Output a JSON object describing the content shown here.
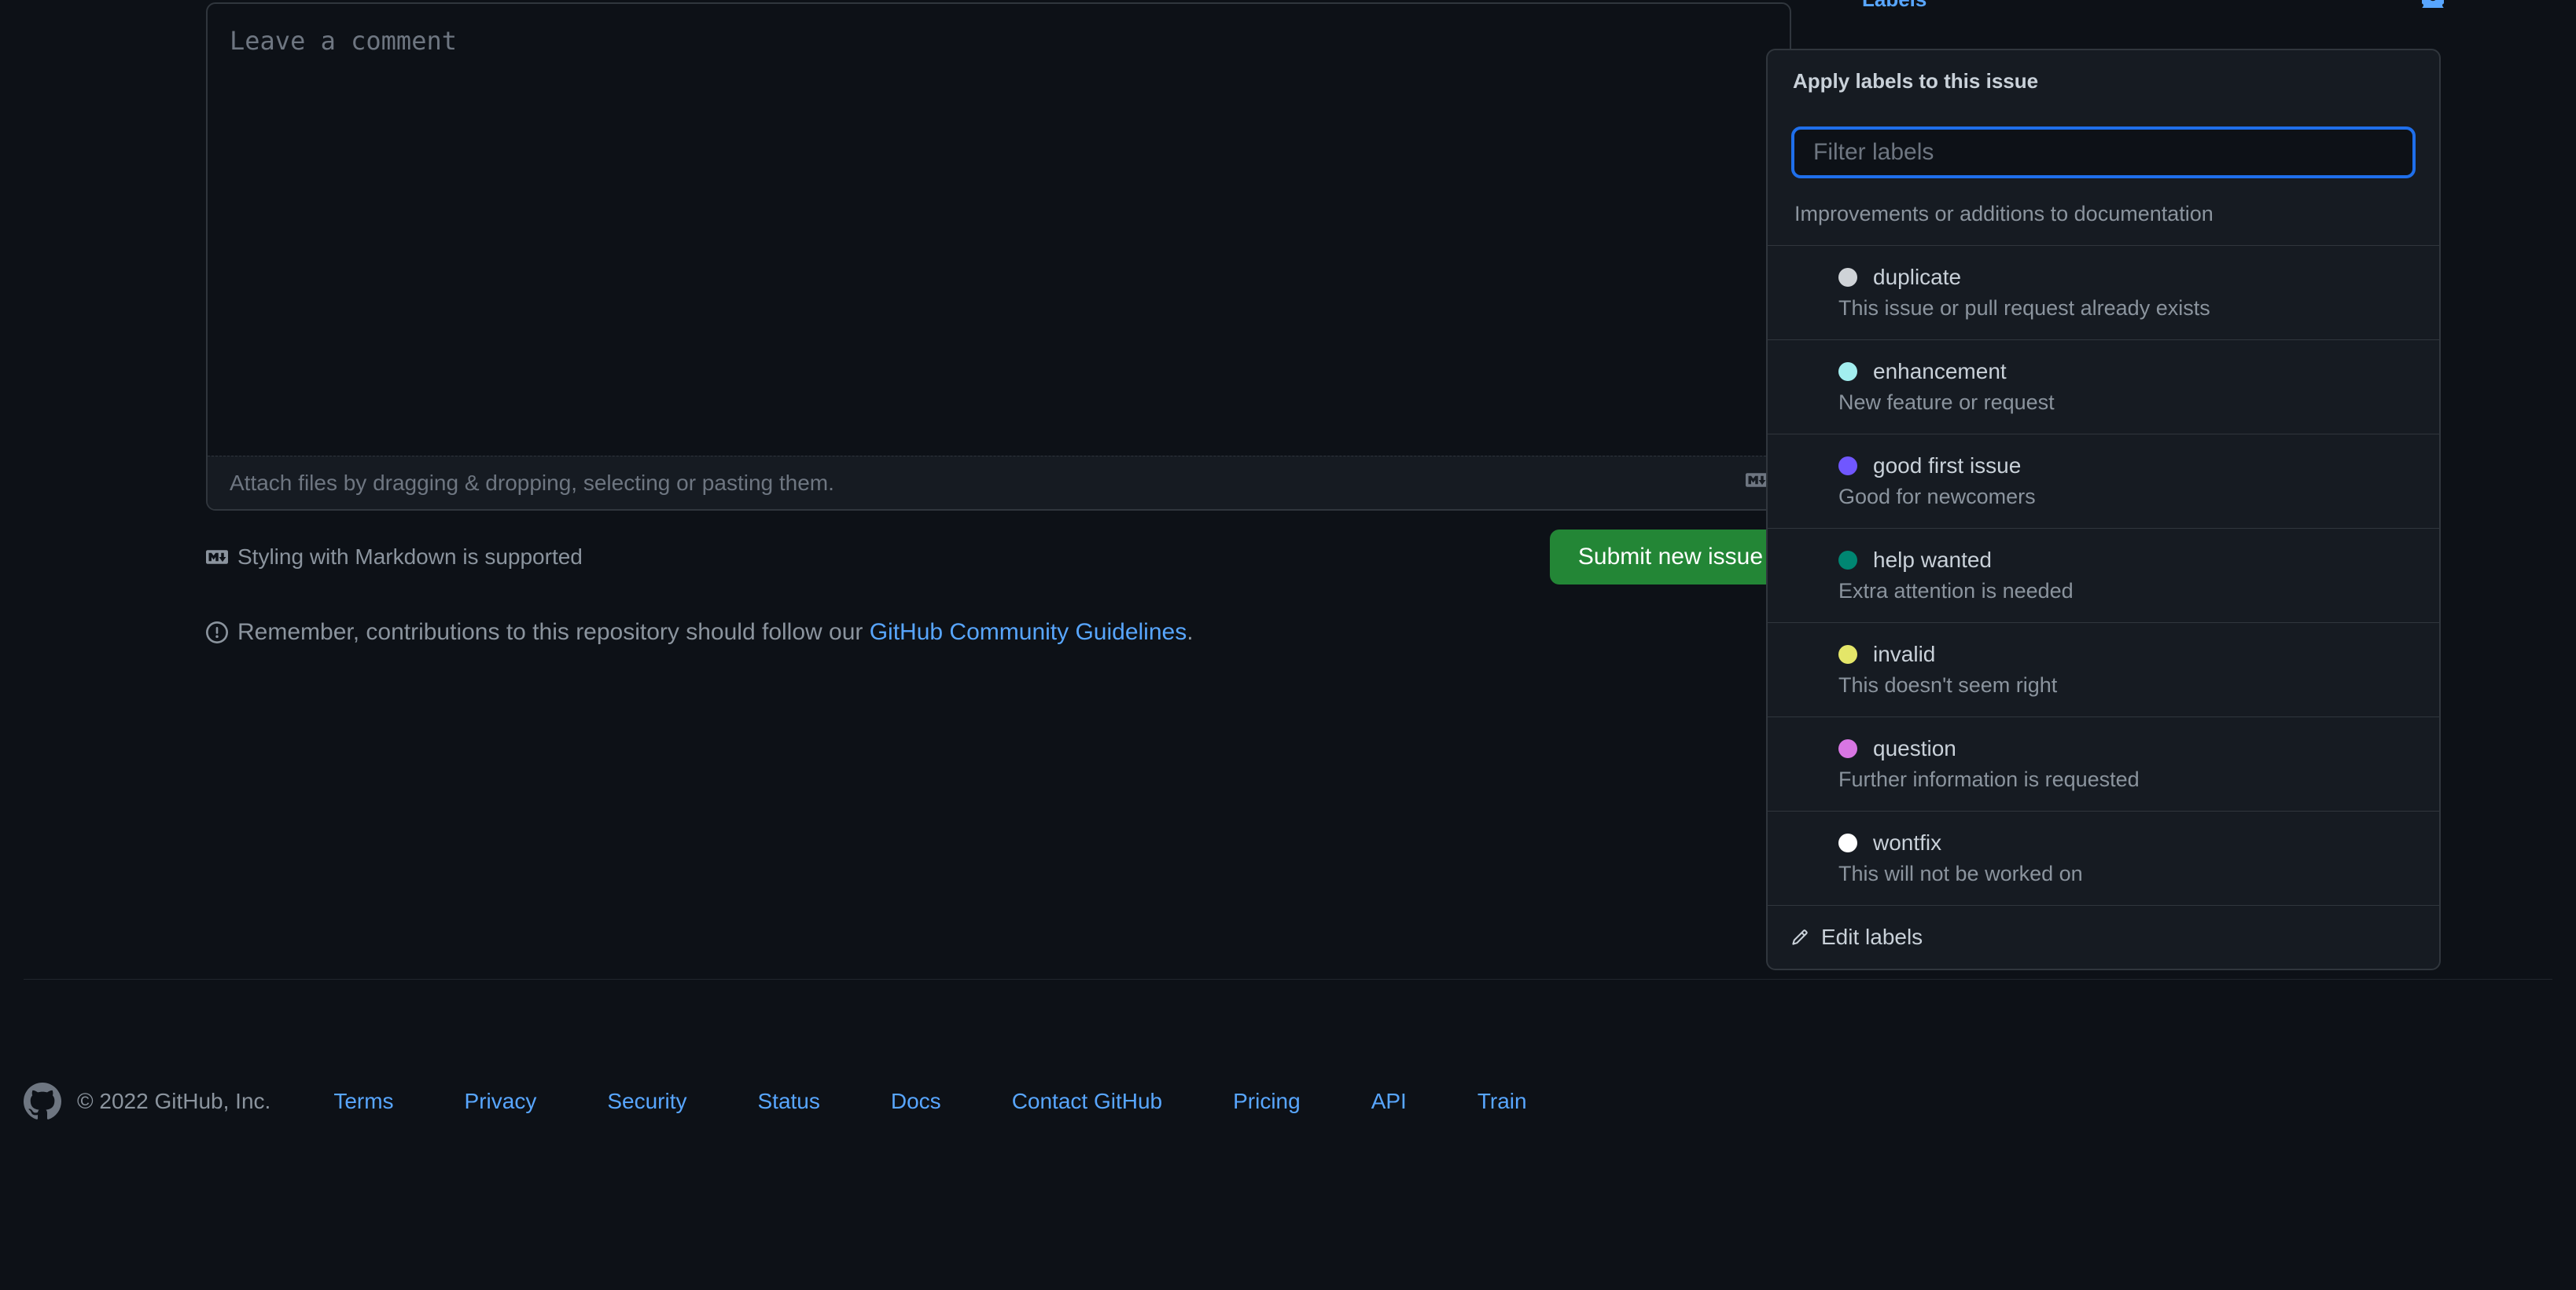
{
  "comment": {
    "placeholder": "Leave a comment",
    "attach_hint": "Attach files by dragging & dropping, selecting or pasting them.",
    "markdown_help": "Styling with Markdown is supported",
    "submit_label": "Submit new issue"
  },
  "guidelines": {
    "prefix": "Remember, contributions to this repository should follow our ",
    "link_text": "GitHub Community Guidelines",
    "suffix": "."
  },
  "footer": {
    "copyright": "© 2022 GitHub, Inc.",
    "links": {
      "terms": "Terms",
      "privacy": "Privacy",
      "security": "Security",
      "status": "Status",
      "docs": "Docs",
      "contact": "Contact GitHub",
      "pricing": "Pricing",
      "api": "API",
      "training": "Train"
    }
  },
  "sidebar": {
    "labels_title": "Labels"
  },
  "popup": {
    "title": "Apply labels to this issue",
    "filter_placeholder": "Filter labels",
    "edit_label": "Edit labels",
    "items": [
      {
        "name": "",
        "desc": "Improvements or additions to documentation",
        "color": ""
      },
      {
        "name": "duplicate",
        "desc": "This issue or pull request already exists",
        "color": "#cfd3d7"
      },
      {
        "name": "enhancement",
        "desc": "New feature or request",
        "color": "#a2eeef"
      },
      {
        "name": "good first issue",
        "desc": "Good for newcomers",
        "color": "#7057ff"
      },
      {
        "name": "help wanted",
        "desc": "Extra attention is needed",
        "color": "#008672"
      },
      {
        "name": "invalid",
        "desc": "This doesn't seem right",
        "color": "#e4e669"
      },
      {
        "name": "question",
        "desc": "Further information is requested",
        "color": "#d876e3"
      },
      {
        "name": "wontfix",
        "desc": "This will not be worked on",
        "color": "#ffffff"
      }
    ]
  }
}
